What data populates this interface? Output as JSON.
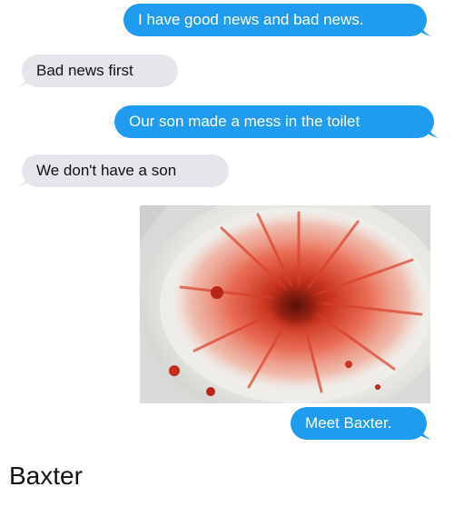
{
  "messages": [
    {
      "side": "sent",
      "text": "I have good news and bad news."
    },
    {
      "side": "received",
      "text": "Bad news first"
    },
    {
      "side": "sent",
      "text": "Our son made a mess in the toilet"
    },
    {
      "side": "received",
      "text": "We don't have a son"
    },
    {
      "side": "sent",
      "type": "image",
      "icon": "toilet-photo"
    },
    {
      "side": "sent",
      "text": "Meet Baxter."
    }
  ],
  "caption": "Baxter",
  "colors": {
    "sent_bubble": "#1f9bf0",
    "received_bubble": "#e6e5eb",
    "text_dark": "#111111",
    "text_light": "#ffffff"
  }
}
